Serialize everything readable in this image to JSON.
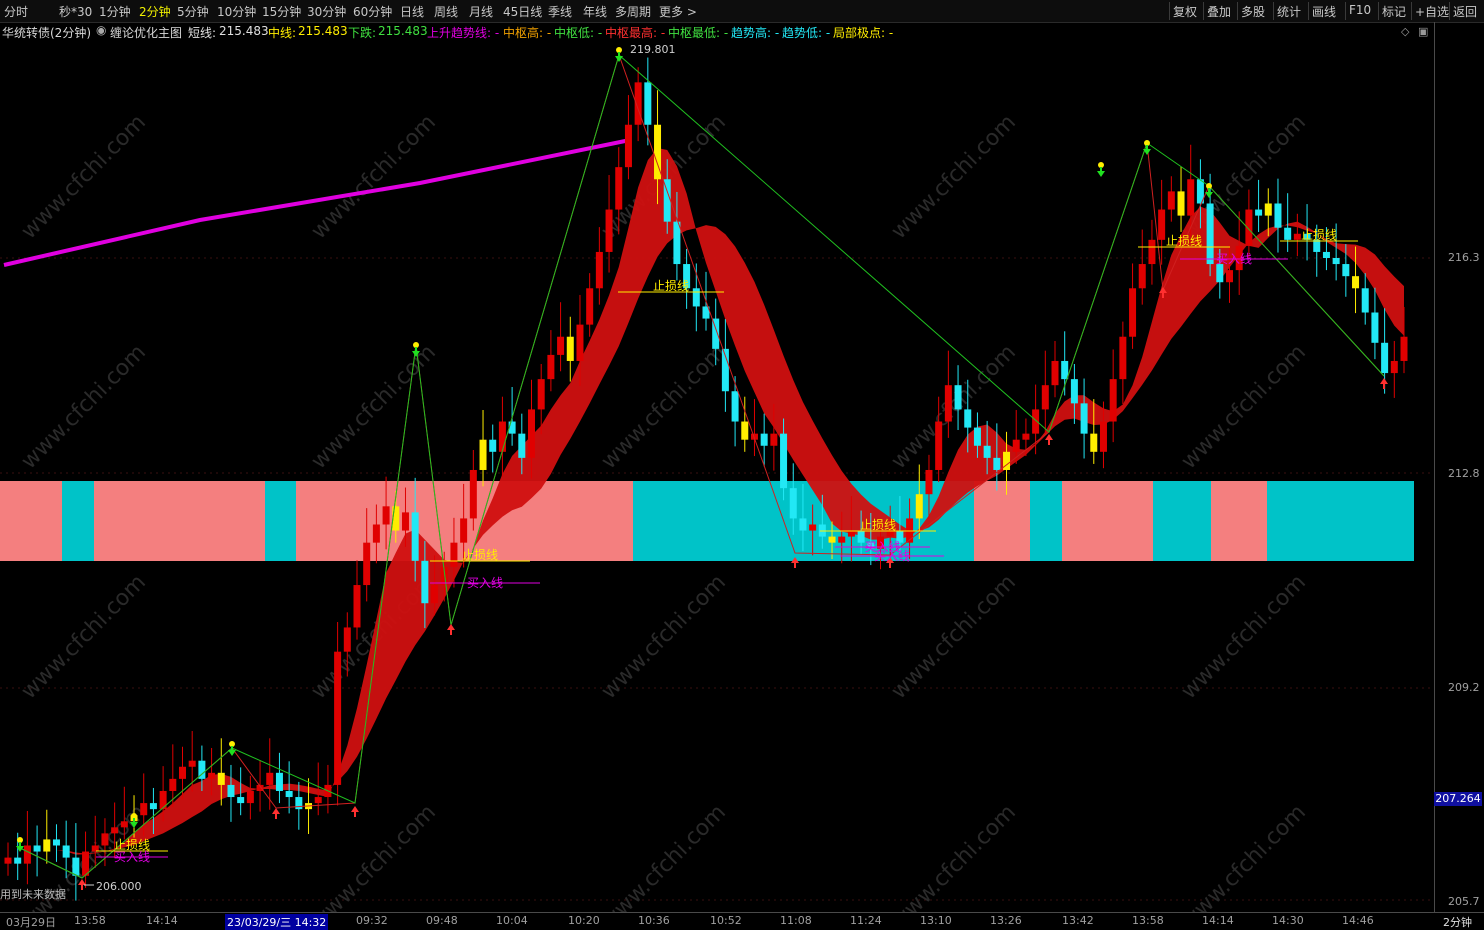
{
  "toolbar": {
    "periods": [
      "分时",
      "秒*30",
      "1分钟",
      "2分钟",
      "5分钟",
      "10分钟",
      "15分钟",
      "30分钟",
      "60分钟",
      "日线",
      "周线",
      "月线",
      "45日线",
      "季线",
      "年线",
      "多周期",
      "更多 >"
    ],
    "active_period": "2分钟",
    "tools": [
      "复权",
      "叠加",
      "多股",
      "统计",
      "画线",
      "F10",
      "标记",
      "+自选",
      "返回"
    ]
  },
  "legend": {
    "title": "华统转债(2分钟)",
    "indicator_name": "缠论优化主图",
    "short_label": "短线:",
    "short_value": "215.483",
    "mid_label": "中线:",
    "mid_value": "215.483",
    "down_label": "下跌:",
    "down_value": "215.483",
    "rise_trend": "上升趋势线: -",
    "pivot_high": "中枢高: -",
    "pivot_low": "中枢低: -",
    "pivot_top": "中枢最高: -",
    "pivot_bottom": "中枢最低: -",
    "trend_high": "趋势高: -",
    "trend_low": "趋势低: -",
    "local_extreme": "局部极点: -"
  },
  "colors": {
    "up": "#e00000",
    "down": "#22e8f5",
    "yellow": "#ffee00",
    "ribbon": "#d01010",
    "ribbon_alt": "#6e8a2a",
    "magenta": "#e000e0",
    "band_pink": "#f47f7f",
    "band_cyan": "#00c3c8"
  },
  "chart_data": {
    "type": "candlestick",
    "y_ticks": [
      "216.3",
      "212.8",
      "209.2",
      "205.7"
    ],
    "last_price_tag": "207.264",
    "high_annotation": "219.801",
    "low_annotation": "206.000",
    "future_data_note": "用到未来数据",
    "stop_loss_label": "止损线",
    "buy_label": "买入线",
    "time_ticks": [
      "03月29日",
      "13:58",
      "14:14",
      "23/03/29/三 14:32",
      "09:32",
      "09:48",
      "10:04",
      "10:20",
      "10:36",
      "10:52",
      "11:08",
      "11:24",
      "13:10",
      "13:26",
      "13:42",
      "13:58",
      "14:14",
      "14:30",
      "14:46"
    ],
    "period_tag": "2分钟",
    "series": [
      {
        "name": "K线",
        "close": [
          206.4,
          206.3,
          206.6,
          206.5,
          206.7,
          206.6,
          206.4,
          206.1,
          206.5,
          206.6,
          206.8,
          206.9,
          207.0,
          207.1,
          207.3,
          207.2,
          207.5,
          207.7,
          207.9,
          208.0,
          207.7,
          207.8,
          207.6,
          207.4,
          207.3,
          207.5,
          207.6,
          207.8,
          207.5,
          207.4,
          207.2,
          207.3,
          207.4,
          207.6,
          209.8,
          210.2,
          210.9,
          211.6,
          211.9,
          212.2,
          211.8,
          212.1,
          211.3,
          210.6,
          210.9,
          211.2,
          211.6,
          212.0,
          212.8,
          213.3,
          213.1,
          213.6,
          213.4,
          213.0,
          213.8,
          214.3,
          214.7,
          215.0,
          214.6,
          215.2,
          215.8,
          216.4,
          217.1,
          217.8,
          218.5,
          219.2,
          218.5,
          217.6,
          216.9,
          216.2,
          215.8,
          215.5,
          215.3,
          214.8,
          214.1,
          213.6,
          213.3,
          213.4,
          213.2,
          213.4,
          212.5,
          212.0,
          211.8,
          211.9,
          211.7,
          211.6,
          211.7,
          211.8,
          211.6,
          211.5,
          211.7,
          211.8,
          211.6,
          212.0,
          212.4,
          212.8,
          213.6,
          214.2,
          213.8,
          213.5,
          213.2,
          213.0,
          212.8,
          213.1,
          213.3,
          213.4,
          213.8,
          214.2,
          214.6,
          214.3,
          213.9,
          213.4,
          213.1,
          213.6,
          214.3,
          215.0,
          215.8,
          216.2,
          216.6,
          217.1,
          217.4,
          217.0,
          217.6,
          217.2,
          216.2,
          215.9,
          216.1,
          216.5,
          217.1,
          217.0,
          217.2,
          216.8,
          216.6,
          216.7,
          216.6,
          216.4,
          216.3,
          216.2,
          216.0,
          215.8,
          215.4,
          214.9,
          214.4,
          214.6,
          215.0
        ]
      }
    ]
  }
}
